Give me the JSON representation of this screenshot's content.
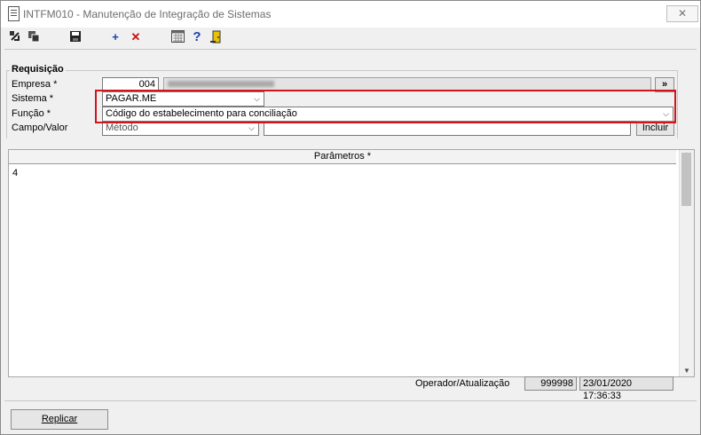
{
  "window": {
    "title": "INTFM010 - Manutenção de Integração de Sistemas",
    "close_glyph": "✕"
  },
  "toolbar": {
    "icons": [
      "first-icon",
      "copy-icon",
      "save-icon",
      "add-icon",
      "delete-icon",
      "calendar-icon",
      "help-icon",
      "exit-icon"
    ],
    "add_glyph": "+",
    "delete_glyph": "✕",
    "help_glyph": "?"
  },
  "requisicao": {
    "title": "Requisição",
    "empresa_label": "Empresa *",
    "empresa_code": "004",
    "empresa_name": "",
    "empresa_button": "»",
    "sistema_label": "Sistema *",
    "sistema_value": "PAGAR.ME",
    "funcao_label": "Função *",
    "funcao_value": "Código do estabelecimento para conciliação",
    "campo_label": "Campo/Valor",
    "campo_value": "Método",
    "valor_value": "",
    "incluir_button": "Incluir"
  },
  "grid": {
    "header": "Parâmetros *",
    "rows": [
      "4"
    ]
  },
  "status": {
    "label": "Operador/Atualização",
    "operator": "999998",
    "updated": "23/01/2020 17:36:33"
  },
  "footer": {
    "replicar_button": "Replicar"
  },
  "colors": {
    "highlight": "#d0161b",
    "add": "#1a3fae",
    "delete": "#cc1111"
  }
}
